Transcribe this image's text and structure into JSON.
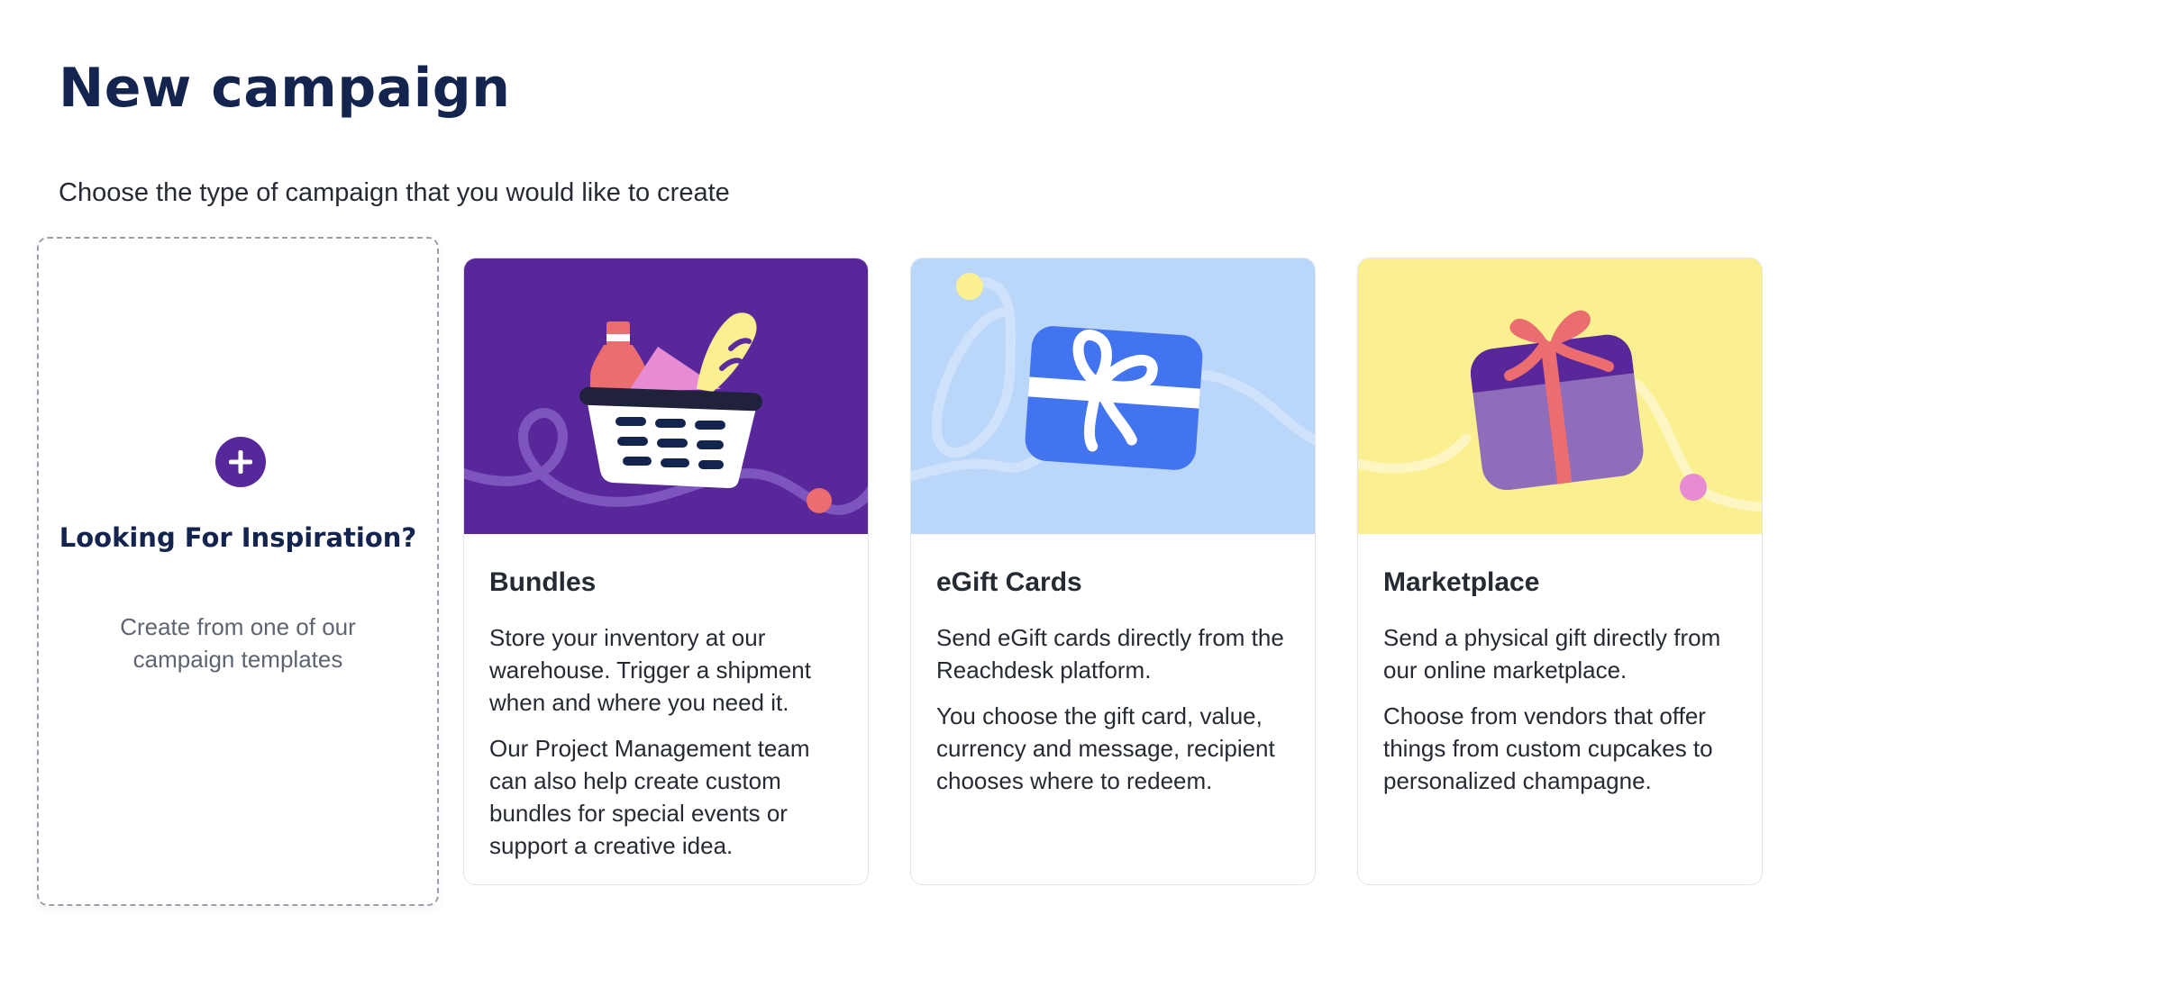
{
  "page": {
    "title": "New campaign",
    "subtitle": "Choose the type of campaign that you would like to create"
  },
  "inspiration": {
    "icon": "plus-circle-icon",
    "title": "Looking For Inspiration?",
    "description": "Create from one of our campaign templates"
  },
  "campaign_types": [
    {
      "title": "Bundles",
      "illustration": "gift-basket-icon",
      "background_color": "#58289b",
      "paragraphs": [
        "Store your inventory at our warehouse. Trigger a shipment when and where you need it.",
        "Our Project Management team can also help create custom bundles for special events or support a creative idea."
      ]
    },
    {
      "title": "eGift Cards",
      "illustration": "gift-card-icon",
      "background_color": "#bad6f9",
      "paragraphs": [
        "Send eGift cards directly from the Reachdesk platform.",
        "You choose the gift card, value, currency and message, recipient chooses where to redeem."
      ]
    },
    {
      "title": "Marketplace",
      "illustration": "gift-box-icon",
      "background_color": "#fbf08f",
      "paragraphs": [
        "Send a physical gift directly from our online marketplace.",
        "Choose from vendors that offer things from custom cupcakes to personalized champagne."
      ]
    }
  ],
  "colors": {
    "title_navy": "#13244e",
    "brand_purple": "#57279c",
    "text_dark": "#252a33",
    "text_muted": "#5e6470"
  }
}
